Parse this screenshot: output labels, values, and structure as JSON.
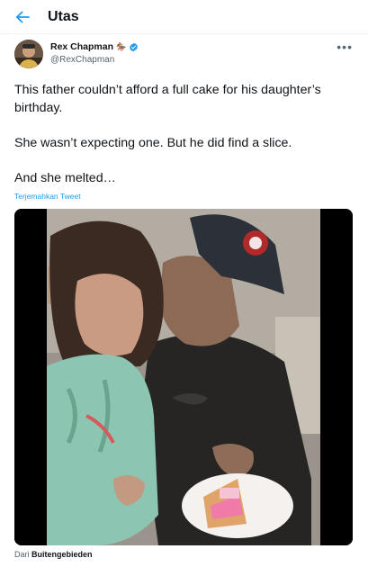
{
  "header": {
    "title": "Utas",
    "back_icon": "arrow-left-icon",
    "accent": "#1d9bf0"
  },
  "tweet": {
    "author_name": "Rex Chapman",
    "author_emoji": "🏇🏼",
    "handle": "@RexChapman",
    "verified": true,
    "more_icon": "more-horizontal-icon",
    "paragraphs": [
      "This father couldn’t afford a full cake for his daughter’s birthday.",
      "She wasn’t expecting one. But he did find a slice.",
      "And she melted…"
    ],
    "translate_label": "Terjemahkan Tweet",
    "media_type": "video"
  },
  "source": {
    "prefix": "Dari",
    "name": "Buitengebieden"
  }
}
